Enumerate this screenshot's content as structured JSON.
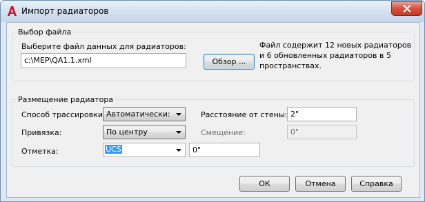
{
  "window": {
    "title": "Импорт радиаторов",
    "app_icon": "autocad-a-icon",
    "close_icon": "close-icon"
  },
  "file_group": {
    "legend": "Выбор файла",
    "prompt": "Выберите файл данных для радиаторов:",
    "file_path": "c:\\MEP\\QA1.1.xml",
    "browse_button": "Обзор ...",
    "info": "Файл содержит 12 новых радиаторов и 6 обновленных радиаторов в 5 пространствах."
  },
  "placement_group": {
    "legend": "Размещение радиатора",
    "routing_label": "Способ трассировки:",
    "routing_value": "Автоматически: Пр",
    "wall_distance_label": "Расстояние от стены:",
    "wall_distance_value": "2\"",
    "snap_label": "Привязка:",
    "snap_value": "По центру",
    "offset_label": "Смещение:",
    "offset_value": "0\"",
    "elevation_label": "Отметка:",
    "elevation_combo": "UCS",
    "elevation_value": "0\""
  },
  "buttons": {
    "ok": "ОК",
    "cancel": "Отмена",
    "help": "Справка"
  },
  "colors": {
    "titlebar": "#d4e0ee",
    "close": "#c43b26",
    "selection": "#3399ff",
    "logo": "#c8102e"
  }
}
